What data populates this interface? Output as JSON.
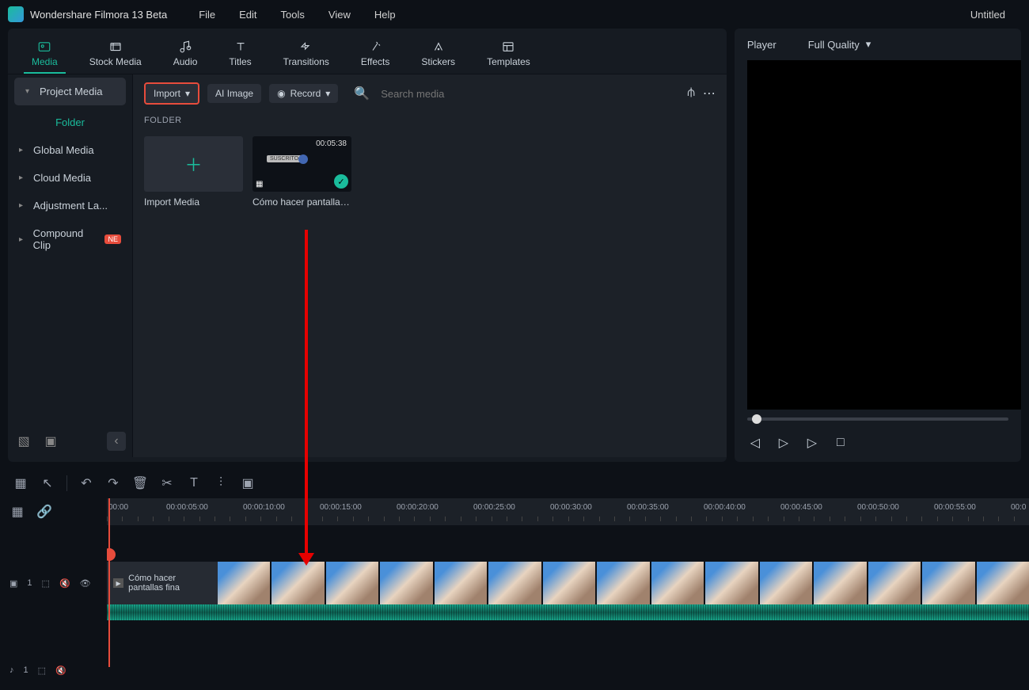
{
  "app": {
    "title": "Wondershare Filmora 13 Beta",
    "doc": "Untitled"
  },
  "menu": {
    "file": "File",
    "edit": "Edit",
    "tools": "Tools",
    "view": "View",
    "help": "Help"
  },
  "tabs": {
    "media": "Media",
    "stock": "Stock Media",
    "audio": "Audio",
    "titles": "Titles",
    "transitions": "Transitions",
    "effects": "Effects",
    "stickers": "Stickers",
    "templates": "Templates"
  },
  "sidebar": {
    "project": "Project Media",
    "folder": "Folder",
    "global": "Global Media",
    "cloud": "Cloud Media",
    "adjustment": "Adjustment La...",
    "compound": "Compound Clip",
    "compound_badge": "NE"
  },
  "toolbar": {
    "import": "Import",
    "ai_image": "AI Image",
    "record": "Record",
    "search_placeholder": "Search media"
  },
  "folderLabel": "FOLDER",
  "cards": {
    "import": "Import Media",
    "clip1_label": "Cómo hacer pantallas ...",
    "clip1_duration": "00:05:38",
    "suscrito": "SUSCRITO"
  },
  "player": {
    "title": "Player",
    "quality": "Full Quality"
  },
  "timeline": {
    "clip_label": "Cómo hacer pantallas fina",
    "track_video": "1",
    "track_audio": "1",
    "ticks": [
      "00:00",
      "00:00:05:00",
      "00:00:10:00",
      "00:00:15:00",
      "00:00:20:00",
      "00:00:25:00",
      "00:00:30:00",
      "00:00:35:00",
      "00:00:40:00",
      "00:00:45:00",
      "00:00:50:00",
      "00:00:55:00",
      "00:0"
    ]
  }
}
